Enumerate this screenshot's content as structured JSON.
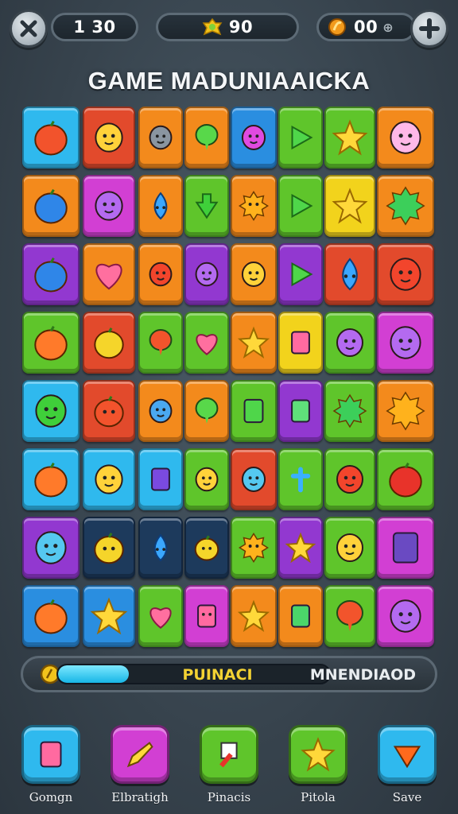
{
  "hud": {
    "moves_value": "1 30",
    "gems_value": "90",
    "coins_value": "00",
    "coins_suffix": "⊕"
  },
  "title": "GAME MADUNIAAICKA",
  "progress": {
    "fill_fraction": 0.26,
    "label": "PUINACI",
    "mode_label": "MNENDIAOD"
  },
  "colors": {
    "cyan": "#2fb9ee",
    "red": "#e24a2c",
    "orange": "#f38a1c",
    "blue": "#2a8ee0",
    "green": "#5fc52b",
    "yellow": "#f2d31c",
    "purple": "#9238d0",
    "magenta": "#d23fd3",
    "navy": "#1d3a5c"
  },
  "board": {
    "rows": [
      [
        {
          "color": "cyan",
          "icon": "tomato-icon"
        },
        {
          "color": "red",
          "icon": "masked-face-icon"
        },
        {
          "color": "orange",
          "icon": "fish-icon",
          "span": 1
        },
        {
          "color": "orange",
          "icon": "speech-bubble-icon"
        },
        {
          "color": "blue",
          "icon": "worm-icon"
        },
        {
          "color": "green",
          "icon": "play-arrow-icon"
        },
        {
          "color": "green",
          "icon": "star-icon"
        },
        {
          "color": "orange",
          "icon": "swirl-bubble-icon"
        }
      ],
      [
        {
          "color": "orange",
          "icon": "blueberry-icon"
        },
        {
          "color": "magenta",
          "icon": "pink-blob-icon"
        },
        {
          "color": "orange",
          "icon": "droplet-creature-icon"
        },
        {
          "color": "green",
          "icon": "down-arrow-icon"
        },
        {
          "color": "orange",
          "icon": "sunglasses-face-icon"
        },
        {
          "color": "green",
          "icon": "green-triangle-icon"
        },
        {
          "color": "yellow",
          "icon": "star-icon"
        },
        {
          "color": "orange",
          "icon": "splat-icon"
        }
      ],
      [
        {
          "color": "purple",
          "icon": "blueberry-icon"
        },
        {
          "color": "orange",
          "icon": "heart-icon"
        },
        {
          "color": "orange",
          "icon": "radish-icon"
        },
        {
          "color": "purple",
          "icon": "ghost-icon"
        },
        {
          "color": "orange",
          "icon": "monster-face-icon"
        },
        {
          "color": "purple",
          "icon": "play-arrow-icon"
        },
        {
          "color": "red",
          "icon": "blue-drop-icon"
        },
        {
          "color": "red",
          "icon": "red-face-icon"
        }
      ],
      [
        {
          "color": "green",
          "icon": "orange-fruit-icon"
        },
        {
          "color": "red",
          "icon": "lemon-icon"
        },
        {
          "color": "green",
          "icon": "balloon-icon"
        },
        {
          "color": "green",
          "icon": "heart-icon"
        },
        {
          "color": "orange",
          "icon": "star-icon"
        },
        {
          "color": "yellow",
          "icon": "jar-icon"
        },
        {
          "color": "green",
          "icon": "purple-face-icon"
        },
        {
          "color": "magenta",
          "icon": "blob-face-icon"
        }
      ],
      [
        {
          "color": "cyan",
          "icon": "green-creature-icon"
        },
        {
          "color": "red",
          "icon": "tomato-face-icon"
        },
        {
          "color": "orange",
          "icon": "mushroom-icon"
        },
        {
          "color": "orange",
          "icon": "speech-bubble-icon"
        },
        {
          "color": "green",
          "icon": "shirt-icon"
        },
        {
          "color": "purple",
          "icon": "potion-icon"
        },
        {
          "color": "green",
          "icon": "splat-icon"
        },
        {
          "color": "orange",
          "icon": "sun-icon"
        }
      ],
      [
        {
          "color": "cyan",
          "icon": "peach-icon"
        },
        {
          "color": "cyan",
          "icon": "crown-hand-icon"
        },
        {
          "color": "cyan",
          "icon": "gift-box-icon"
        },
        {
          "color": "green",
          "icon": "flower-pot-icon"
        },
        {
          "color": "red",
          "icon": "blue-face-icon"
        },
        {
          "color": "green",
          "icon": "cross-icon"
        },
        {
          "color": "green",
          "icon": "red-creature-icon"
        },
        {
          "color": "green",
          "icon": "red-ball-icon"
        }
      ],
      [
        {
          "color": "purple",
          "icon": "blue-face-icon"
        },
        {
          "color": "navy",
          "icon": "lemon-face-icon"
        },
        {
          "color": "navy",
          "icon": "blue-drop-icon"
        },
        {
          "color": "navy",
          "icon": "lemon-face-icon"
        },
        {
          "color": "green",
          "icon": "sun-face-icon"
        },
        {
          "color": "purple",
          "icon": "star-icon"
        },
        {
          "color": "green",
          "icon": "yellow-flower-icon"
        },
        {
          "color": "magenta",
          "icon": "screen-icon"
        }
      ],
      [
        {
          "color": "blue",
          "icon": "orange-fruit-icon"
        },
        {
          "color": "blue",
          "icon": "star-icon"
        },
        {
          "color": "green",
          "icon": "heart-icon"
        },
        {
          "color": "magenta",
          "icon": "jar-face-icon"
        },
        {
          "color": "orange",
          "icon": "star-icon"
        },
        {
          "color": "orange",
          "icon": "card-icon"
        },
        {
          "color": "green",
          "icon": "balloon-icon"
        },
        {
          "color": "magenta",
          "icon": "skull-icon"
        }
      ]
    ]
  },
  "dock": [
    {
      "label": "Gomgn",
      "color": "cyan",
      "icon": "capsule-icon"
    },
    {
      "label": "Elbratigh",
      "color": "magenta",
      "icon": "pencil-icon"
    },
    {
      "label": "Pinacis",
      "color": "green",
      "icon": "paint-brush-icon"
    },
    {
      "label": "Pitola",
      "color": "green",
      "icon": "star-icon"
    },
    {
      "label": "Save",
      "color": "cyan",
      "icon": "shield-icon"
    }
  ]
}
